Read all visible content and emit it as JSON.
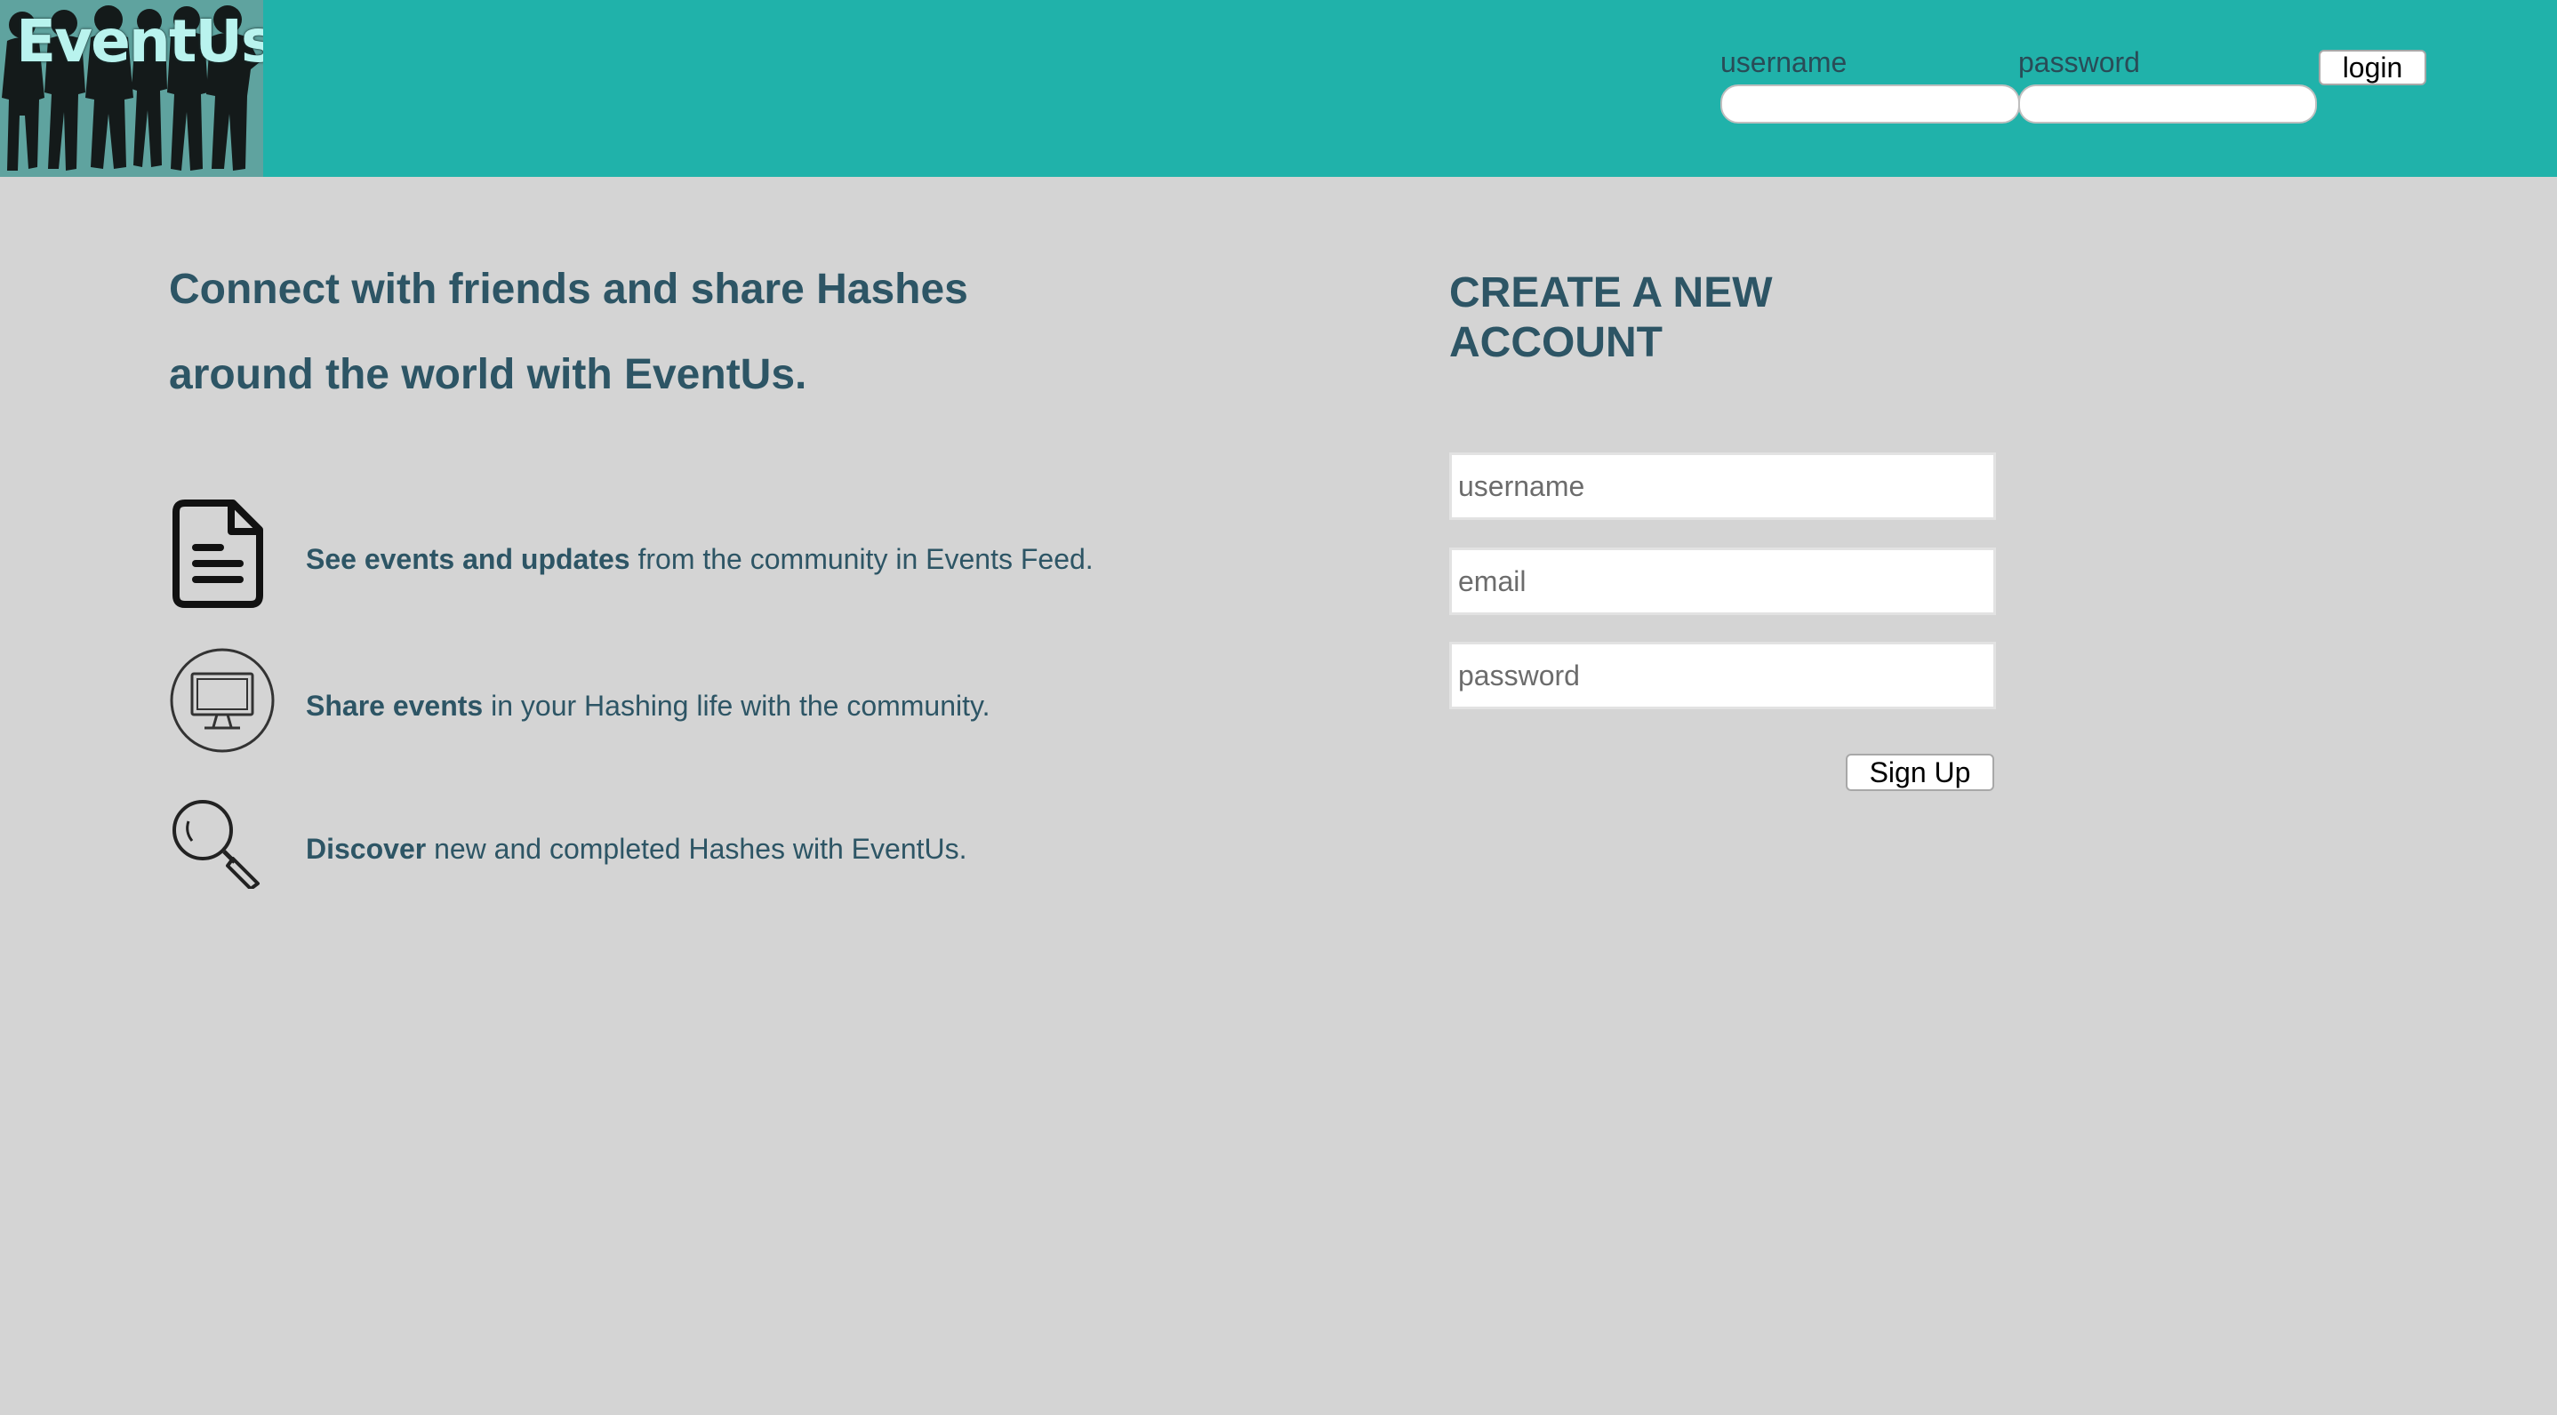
{
  "header": {
    "logo_text": "EventUs",
    "username_label": "username",
    "password_label": "password",
    "login_button": "login"
  },
  "hero": {
    "headline_line1": "Connect with friends and share Hashes",
    "headline_line2": "around the world with EventUs."
  },
  "features": [
    {
      "icon": "document-icon",
      "bold": "See events and updates",
      "text": " from the community in Events Feed."
    },
    {
      "icon": "monitor-icon",
      "bold": "Share events",
      "text": " in your Hashing life with the community."
    },
    {
      "icon": "magnifier-icon",
      "bold": "Discover",
      "text": " new and completed Hashes with EventUs."
    }
  ],
  "signup": {
    "title_line1": "CREATE A NEW",
    "title_line2": "ACCOUNT",
    "username_placeholder": "username",
    "email_placeholder": "email",
    "password_placeholder": "password",
    "button": "Sign Up"
  },
  "colors": {
    "header_bg": "#20b2aa",
    "page_bg": "#d4d4d4",
    "text": "#2d5565"
  }
}
